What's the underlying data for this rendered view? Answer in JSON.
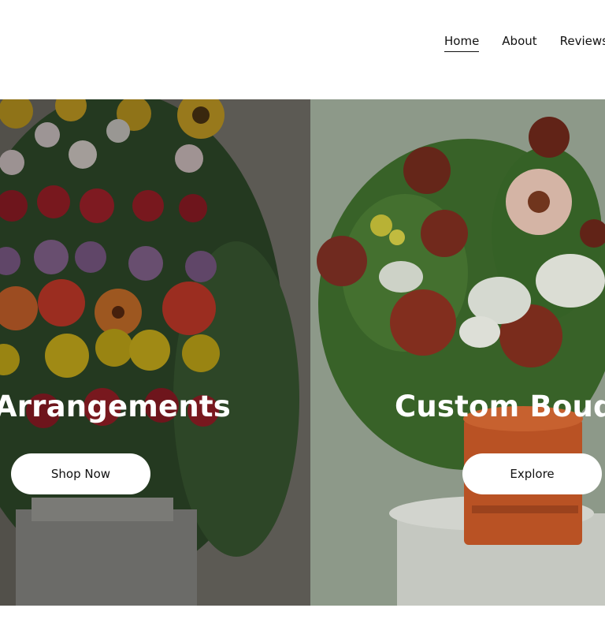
{
  "nav": {
    "items": [
      {
        "label": "Home",
        "active": true
      },
      {
        "label": "About",
        "active": false
      },
      {
        "label": "Reviews",
        "active": false
      }
    ]
  },
  "hero": {
    "left": {
      "title": "al Arrangements",
      "button": "Shop Now"
    },
    "right": {
      "title": "Custom Bouqu",
      "button": "Explore"
    }
  },
  "colors": {
    "left_panel": "#5d5a52",
    "right_panel": "#8f9a86",
    "button_bg": "#ffffff",
    "text_on_image": "#ffffff"
  }
}
